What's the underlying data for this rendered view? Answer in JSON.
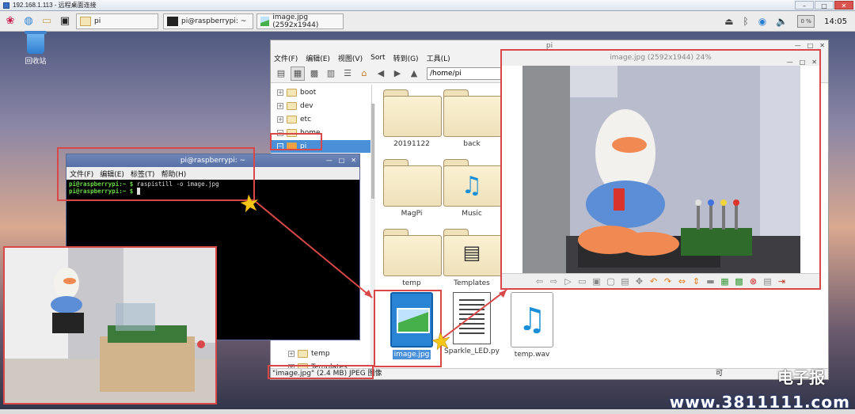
{
  "rdp": {
    "title": "192.168.1.113 - 远程桌面连接"
  },
  "taskbar": {
    "tasks": [
      {
        "label": "pi"
      },
      {
        "label": "pi@raspberrypi: ~"
      },
      {
        "label": "image.jpg (2592x1944)"
      }
    ],
    "cpu": "0 %",
    "clock": "14:05"
  },
  "desktop": {
    "trash_label": "回收站"
  },
  "file_manager": {
    "title": "pi",
    "menu": [
      "文件(F)",
      "编辑(E)",
      "视图(V)",
      "Sort",
      "转到(G)",
      "工具(L)"
    ],
    "path": "/home/pi",
    "tree": [
      "boot",
      "dev",
      "etc",
      "home",
      "pi",
      "temp",
      "Templates"
    ],
    "files": [
      {
        "name": "20191122",
        "kind": "folder"
      },
      {
        "name": "back",
        "kind": "folder"
      },
      {
        "name": "MagPi",
        "kind": "folder"
      },
      {
        "name": "Music",
        "kind": "music-folder"
      },
      {
        "name": "temp",
        "kind": "folder"
      },
      {
        "name": "Templates",
        "kind": "templates-folder"
      },
      {
        "name": "image.jpg",
        "kind": "image"
      },
      {
        "name": "Sparkle_LED.py",
        "kind": "text"
      },
      {
        "name": "temp.wav",
        "kind": "audio"
      }
    ],
    "status": "\"image.jpg\" (2.4 MB) JPEG 图像",
    "status_right": "可"
  },
  "viewer": {
    "title": "image.jpg (2592x1944) 24%"
  },
  "terminal": {
    "title": "pi@raspberrypi: ~",
    "menu": [
      "文件(F)",
      "编辑(E)",
      "标签(T)",
      "帮助(H)"
    ],
    "line1_prompt": "pi@raspberrypi:~ $",
    "line1_cmd": " raspistill -o image.jpg",
    "line2_prompt": "pi@raspberrypi:~ $"
  },
  "watermark": {
    "text": "电子报",
    "site": "www.3811111.com"
  },
  "colors": {
    "annotation": "#d94848",
    "selection": "#4a90d9",
    "terminal_bg": "#000000"
  }
}
